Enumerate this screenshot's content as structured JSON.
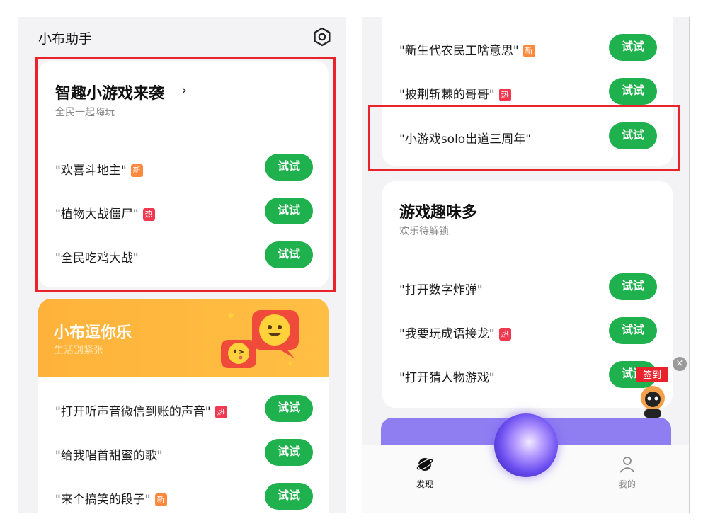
{
  "left_screen": {
    "app_title": "小布助手",
    "top_card": {
      "title": "智趣小游戏来袭",
      "subtitle": "全民一起嗨玩",
      "items": [
        {
          "text": "\"欢喜斗地主\"",
          "badge": "新",
          "button": "试试"
        },
        {
          "text": "\"植物大战僵尸\"",
          "badge": "热",
          "button": "试试"
        },
        {
          "text": "\"全民吃鸡大战\"",
          "badge": "",
          "button": "试试"
        }
      ]
    },
    "banner": {
      "title": "小布逗你乐",
      "subtitle": "生活别紧张",
      "items": [
        {
          "text": "\"打开听声音微信到账的声音\"",
          "badge": "热",
          "button": "试试"
        },
        {
          "text": "\"给我唱首甜蜜的歌\"",
          "badge": "",
          "button": "试试"
        },
        {
          "text": "\"来个搞笑的段子\"",
          "badge": "新",
          "button": "试试"
        }
      ]
    }
  },
  "right_screen": {
    "top_items": [
      {
        "text": "\"新生代农民工啥意思\"",
        "badge": "新",
        "button": "试试"
      },
      {
        "text": "\"披荆斩棘的哥哥\"",
        "badge": "热",
        "button": "试试"
      },
      {
        "text": "\"小游戏solo出道三周年\"",
        "badge": "",
        "button": "试试"
      }
    ],
    "game_card": {
      "title": "游戏趣味多",
      "subtitle": "欢乐待解锁",
      "items": [
        {
          "text": "\"打开数字炸弹\"",
          "badge": "",
          "button": "试试"
        },
        {
          "text": "\"我要玩成语接龙\"",
          "badge": "热",
          "button": "试试"
        },
        {
          "text": "\"打开猜人物游戏\"",
          "badge": "",
          "button": "试试"
        }
      ]
    },
    "checkin_label": "签到",
    "bottom_nav": {
      "discover": "发现",
      "mine": "我的"
    }
  },
  "colors": {
    "accent_green": "#1fb14d",
    "highlight_red": "#e8232b",
    "badge_new": "#ff8a3d",
    "badge_hot": "#f0384f",
    "banner_orange": "#ffb23a"
  }
}
